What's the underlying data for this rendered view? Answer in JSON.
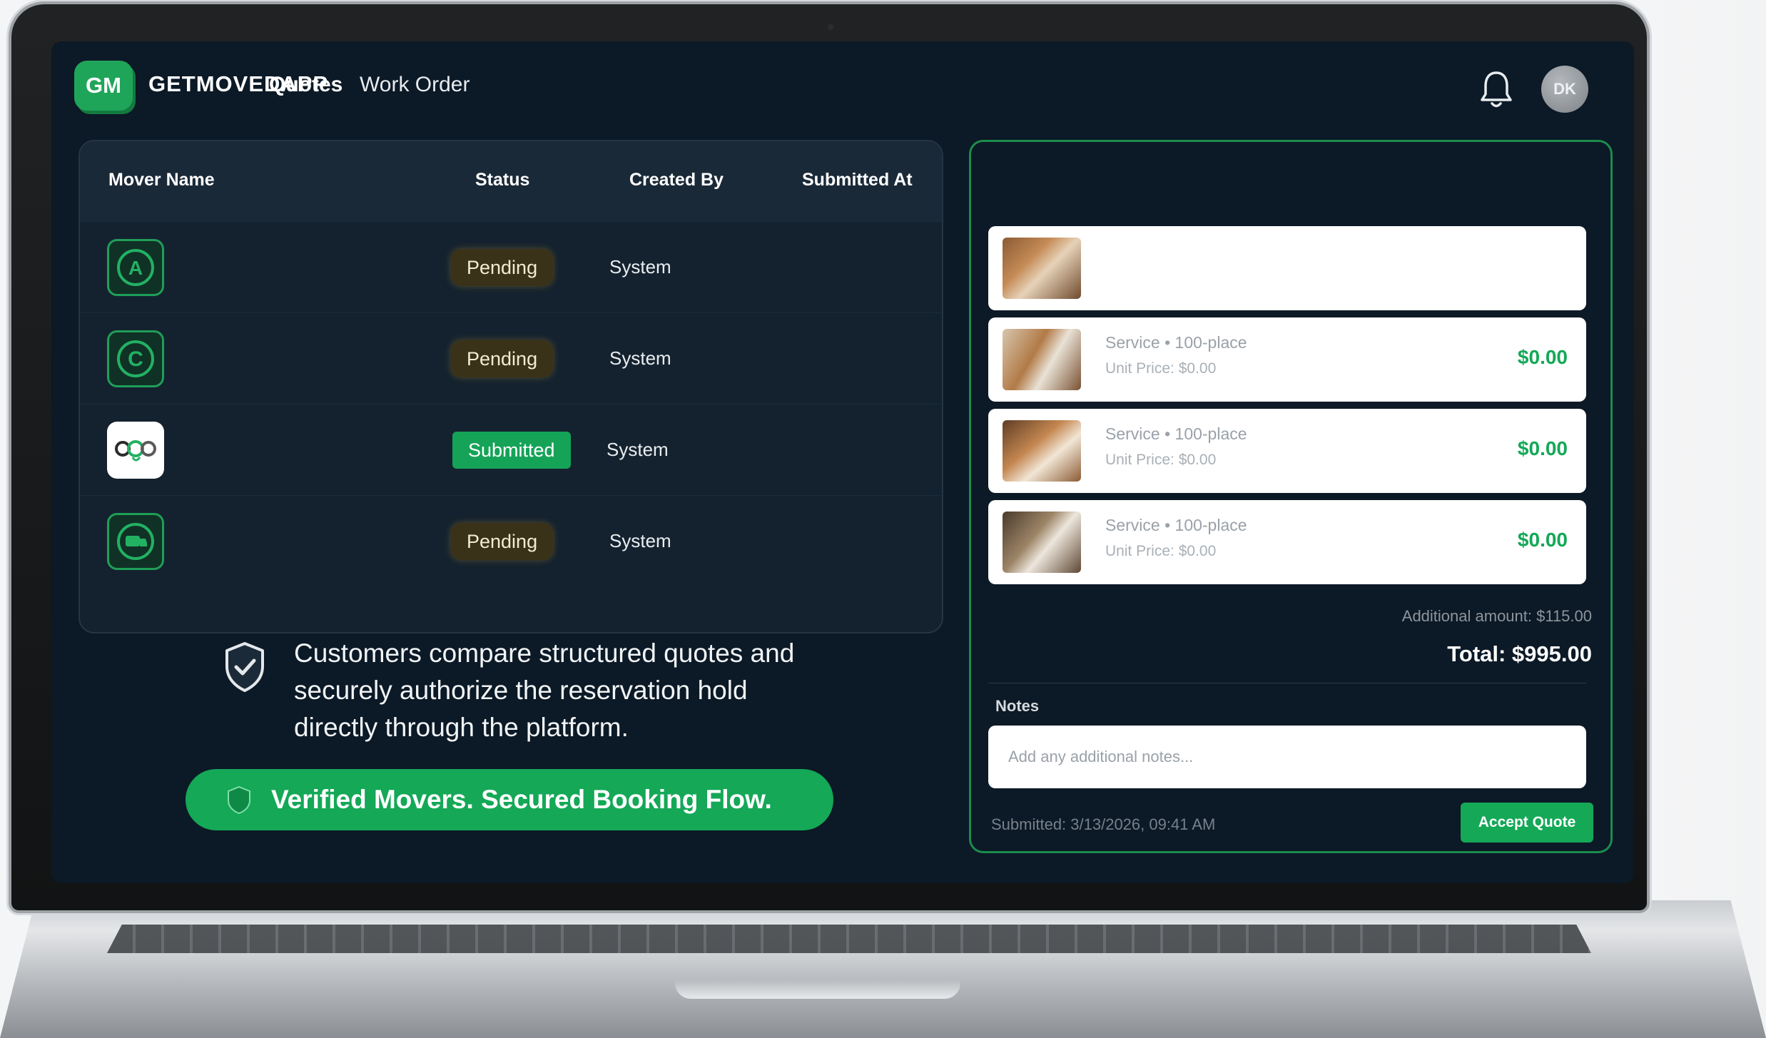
{
  "app": {
    "logo_initials": "GM",
    "name": "GETMOVEDAPP"
  },
  "nav": {
    "tabs": [
      "Quotes",
      "Work Order"
    ],
    "active": "Quotes"
  },
  "user": {
    "avatar_initials": "DK"
  },
  "table": {
    "columns": [
      "Mover Name",
      "Status",
      "Created By",
      "Submitted At"
    ],
    "rows": [
      {
        "logo_letter": "A",
        "status": "Pending",
        "created_by": "System"
      },
      {
        "logo_letter": "C",
        "status": "Pending",
        "created_by": "System"
      },
      {
        "logo_letter": "",
        "status": "Submitted",
        "created_by": "System"
      },
      {
        "logo_letter": "",
        "status": "Pending",
        "created_by": "System"
      }
    ]
  },
  "info": {
    "text": "Customers compare structured quotes and securely authorize the reservation hold directly through the platform."
  },
  "cta": {
    "label": "Verified Movers. Secured Booking Flow."
  },
  "quote": {
    "items": [
      {
        "title": "",
        "sub": "",
        "price": ""
      },
      {
        "title": "Service • 100-place",
        "sub": "Unit Price: $0.00",
        "price": "$0.00"
      },
      {
        "title": "Service • 100-place",
        "sub": "Unit Price: $0.00",
        "price": "$0.00"
      },
      {
        "title": "Service • 100-place",
        "sub": "Unit Price: $0.00",
        "price": "$0.00"
      }
    ],
    "additional_amount": "Additional amount: $115.00",
    "total": "Total: $995.00",
    "notes_label": "Notes",
    "notes_placeholder": "Add any additional notes...",
    "submitted": "Submitted: 3/13/2026, 09:41 AM",
    "accept_label": "Accept Quote"
  },
  "colors": {
    "accent": "#14a857",
    "background": "#0c1926",
    "pending": "#3a3218"
  }
}
